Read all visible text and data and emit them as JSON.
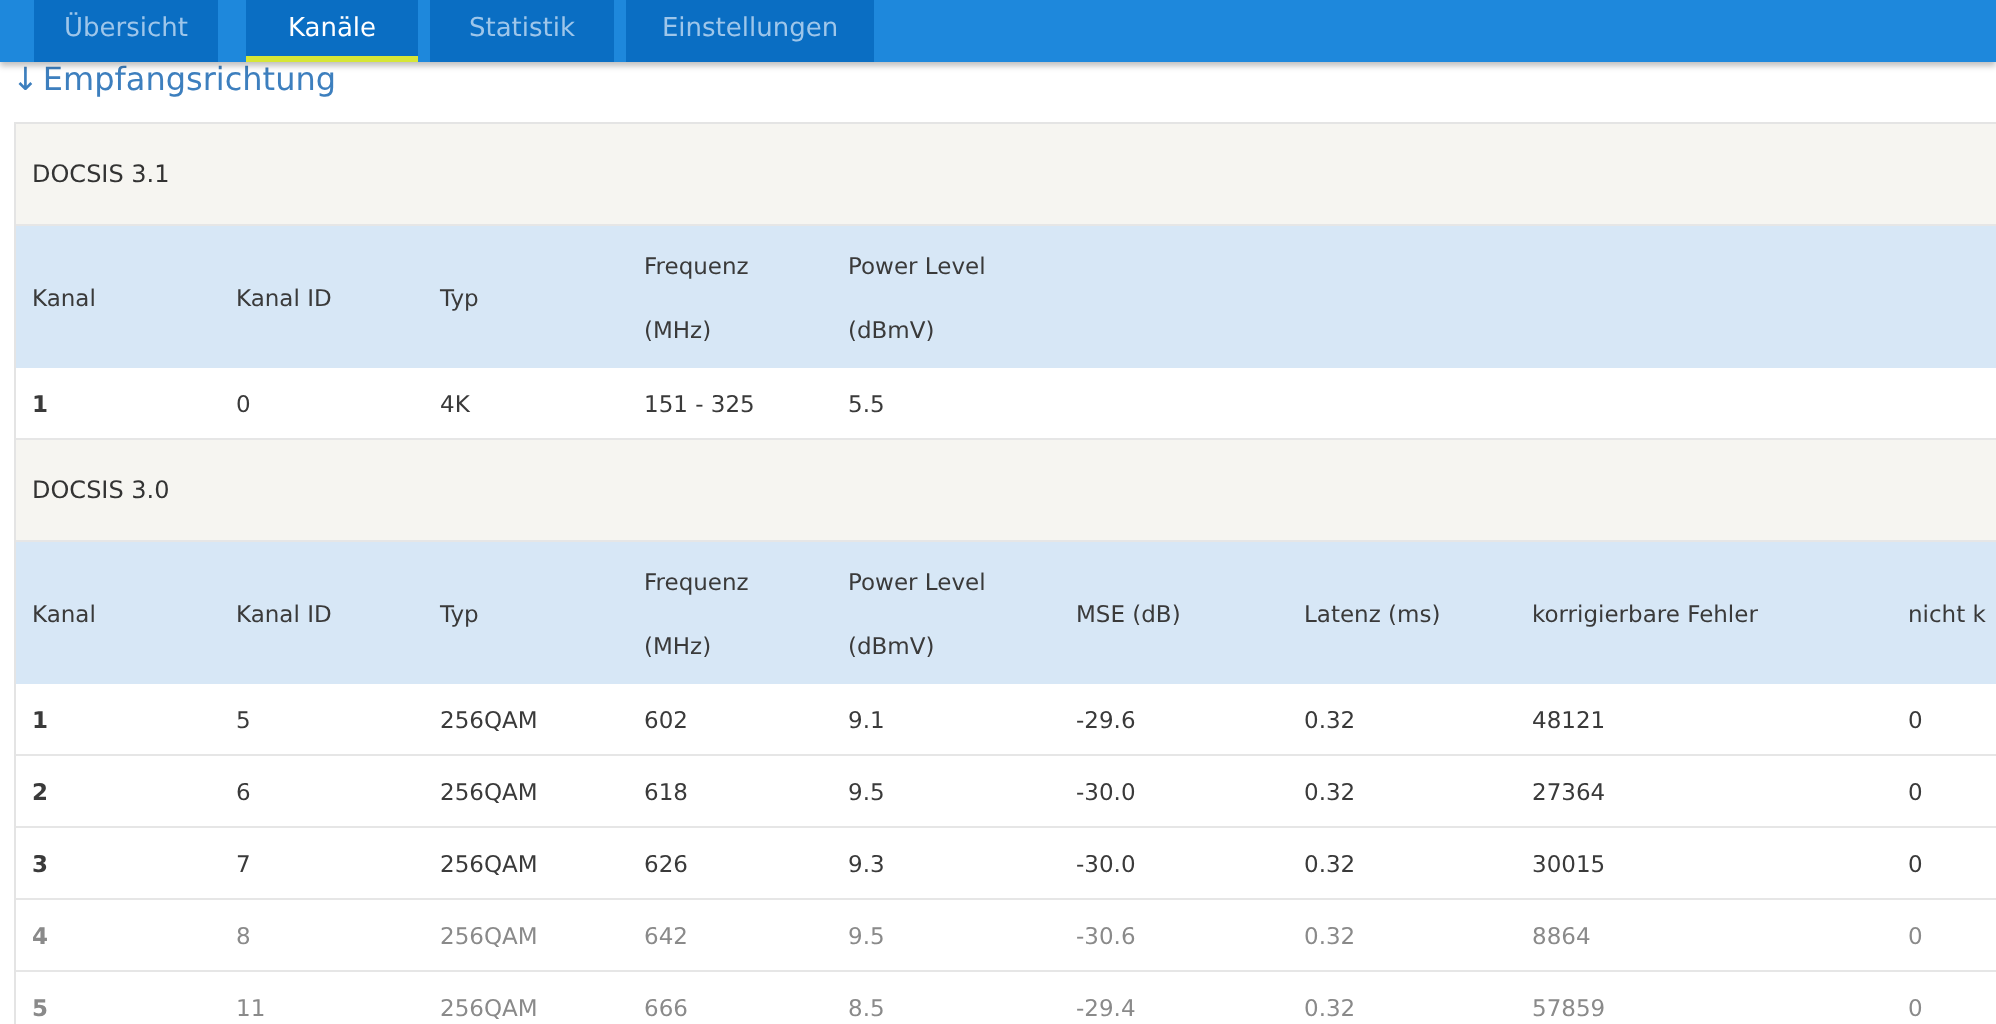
{
  "tabs": [
    {
      "label": "Übersicht",
      "selected": false
    },
    {
      "label": "Kanäle",
      "selected": true
    },
    {
      "label": "Statistik",
      "selected": false
    },
    {
      "label": "Einstellungen",
      "selected": false
    }
  ],
  "heading": {
    "arrow": "↓",
    "text": "Empfangsrichtung"
  },
  "sections": [
    {
      "title": "DOCSIS 3.1",
      "columns": [
        "Kanal",
        "Kanal ID",
        "Typ",
        "Frequenz\n(MHz)",
        "Power Level\n(dBmV)"
      ],
      "rows": [
        {
          "faded": false,
          "cells": [
            "1",
            "0",
            "4K",
            "151 - 325",
            "5.5"
          ]
        }
      ]
    },
    {
      "title": "DOCSIS 3.0",
      "columns": [
        "Kanal",
        "Kanal ID",
        "Typ",
        "Frequenz\n(MHz)",
        "Power Level\n(dBmV)",
        "MSE (dB)",
        "Latenz (ms)",
        "korrigierbare Fehler",
        "nicht k"
      ],
      "rows": [
        {
          "faded": false,
          "cells": [
            "1",
            "5",
            "256QAM",
            "602",
            "9.1",
            "-29.6",
            "0.32",
            "48121",
            "0"
          ]
        },
        {
          "faded": false,
          "cells": [
            "2",
            "6",
            "256QAM",
            "618",
            "9.5",
            "-30.0",
            "0.32",
            "27364",
            "0"
          ]
        },
        {
          "faded": false,
          "cells": [
            "3",
            "7",
            "256QAM",
            "626",
            "9.3",
            "-30.0",
            "0.32",
            "30015",
            "0"
          ]
        },
        {
          "faded": true,
          "cells": [
            "4",
            "8",
            "256QAM",
            "642",
            "9.5",
            "-30.6",
            "0.32",
            "8864",
            "0"
          ]
        },
        {
          "faded": true,
          "cells": [
            "5",
            "11",
            "256QAM",
            "666",
            "8.5",
            "-29.4",
            "0.32",
            "57859",
            "0"
          ]
        }
      ]
    }
  ]
}
